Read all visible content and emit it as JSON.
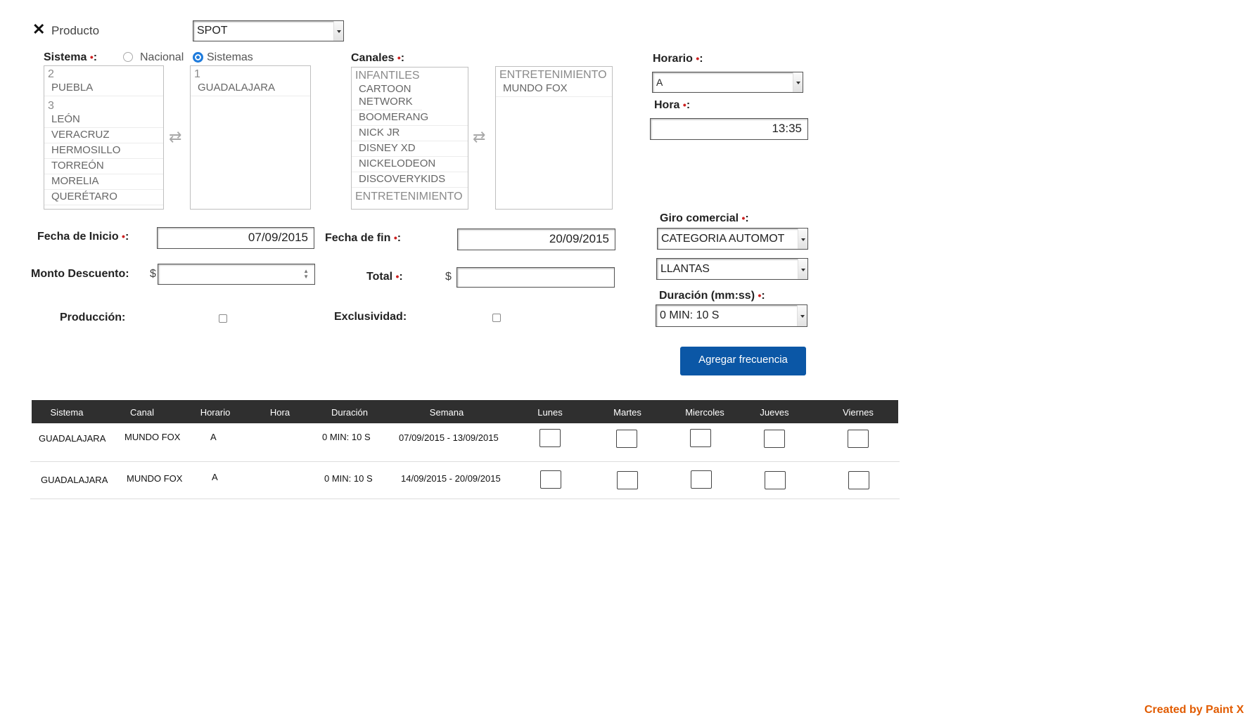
{
  "producto": {
    "label": "Producto",
    "value": "SPOT"
  },
  "sistema": {
    "label": "Sistema",
    "radio_nacional": "Nacional",
    "radio_sistemas": "Sistemas",
    "left_list": {
      "groups": [
        {
          "title": "2",
          "items": [
            "PUEBLA"
          ]
        },
        {
          "title": "3",
          "items": [
            "LEÓN",
            "VERACRUZ",
            "HERMOSILLO",
            "TORREÓN",
            "MORELIA",
            "QUERÉTARO"
          ]
        }
      ]
    },
    "right_list": {
      "groups": [
        {
          "title": "1",
          "items": [
            "GUADALAJARA"
          ]
        }
      ]
    }
  },
  "canales": {
    "label": "Canales",
    "left_list": {
      "groups": [
        {
          "title": "INFANTILES",
          "items": [
            "CARTOON NETWORK",
            "BOOMERANG",
            "NICK JR",
            "DISNEY XD",
            "NICKELODEON",
            "DISCOVERYKIDS"
          ]
        },
        {
          "title": "ENTRETENIMIENTO",
          "items": []
        }
      ]
    },
    "right_list": {
      "groups": [
        {
          "title": "ENTRETENIMIENTO",
          "items": [
            "MUNDO FOX"
          ]
        }
      ]
    }
  },
  "horario": {
    "label": "Horario",
    "value": "A"
  },
  "hora": {
    "label": "Hora",
    "value": "13:35"
  },
  "fecha_inicio": {
    "label": "Fecha de Inicio",
    "value": "07/09/2015"
  },
  "fecha_fin": {
    "label": "Fecha de fin",
    "value": "20/09/2015"
  },
  "giro": {
    "label": "Giro comercial",
    "value1": "CATEGORIA AUTOMOT",
    "value2": "LLANTAS"
  },
  "monto": {
    "label": "Monto Descuento:",
    "currency": "$",
    "value": ""
  },
  "total": {
    "label": "Total",
    "currency": "$",
    "value": ""
  },
  "duracion": {
    "label": "Duración (mm:ss)",
    "value": "0 MIN: 10 S"
  },
  "produccion": {
    "label": "Producción:"
  },
  "exclusividad": {
    "label": "Exclusividad:"
  },
  "agregar_button": "Agregar frecuencia",
  "table": {
    "headers": [
      "Sistema",
      "Canal",
      "Horario",
      "Hora",
      "Duración",
      "Semana",
      "Lunes",
      "Martes",
      "Miercoles",
      "Jueves",
      "Viernes"
    ],
    "rows": [
      {
        "sistema": "GUADALAJARA",
        "canal": "MUNDO FOX",
        "horario": "A",
        "hora": "",
        "duracion": "0 MIN: 10 S",
        "semana": "07/09/2015 - 13/09/2015"
      },
      {
        "sistema": "GUADALAJARA",
        "canal": "MUNDO FOX",
        "horario": "A",
        "hora": "",
        "duracion": "0 MIN: 10 S",
        "semana": "14/09/2015 - 20/09/2015"
      }
    ]
  },
  "watermark": "Created by Paint X",
  "colors": {
    "accent": "#0b57a6",
    "required": "#cc1f1f",
    "table_header": "#2f2f2f",
    "watermark": "#e15b00"
  }
}
